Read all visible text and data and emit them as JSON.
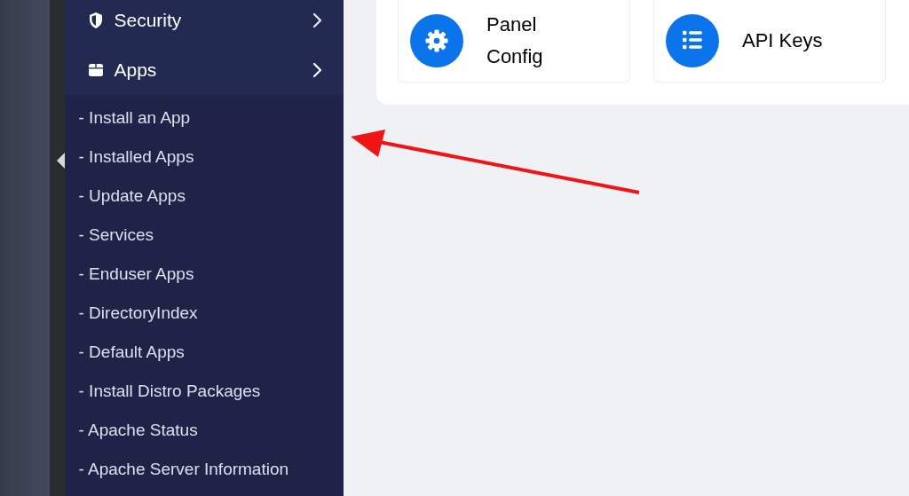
{
  "sidebar": {
    "sections": [
      {
        "label": "Security",
        "expanded": false
      },
      {
        "label": "Apps",
        "expanded": true,
        "children": [
          {
            "label": "- Install an App"
          },
          {
            "label": "- Installed Apps"
          },
          {
            "label": "- Update Apps"
          },
          {
            "label": "- Services"
          },
          {
            "label": "- Enduser Apps"
          },
          {
            "label": "- DirectoryIndex"
          },
          {
            "label": "- Default Apps"
          },
          {
            "label": "- Install Distro Packages"
          },
          {
            "label": "- Apache Status"
          },
          {
            "label": "- Apache Server Information"
          }
        ]
      }
    ]
  },
  "cards": [
    {
      "label": "Panel Config"
    },
    {
      "label": "API Keys"
    }
  ]
}
